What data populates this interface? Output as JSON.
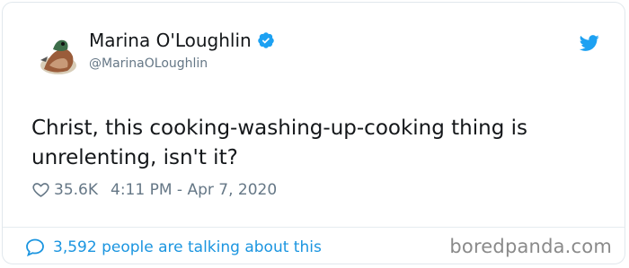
{
  "author": {
    "display_name": "Marina O'Loughlin",
    "handle": "@MarinaOLoughlin",
    "verified": true
  },
  "tweet": {
    "text": "Christ, this cooking-washing-up-cooking thing is unrelenting, isn't it?",
    "likes": "35.6K",
    "timestamp": "4:11 PM - Apr 7, 2020"
  },
  "footer": {
    "conversation_label": "3,592 people are talking about this"
  },
  "watermark": "boredpanda.com",
  "icons": {
    "verified": "verified-badge-icon",
    "brand": "twitter-bird-icon",
    "like": "heart-outline-icon",
    "conversation": "speech-bubble-icon"
  },
  "colors": {
    "accent": "#1da1f2",
    "link": "#1b95e0",
    "text": "#14171a",
    "muted": "#657786"
  }
}
